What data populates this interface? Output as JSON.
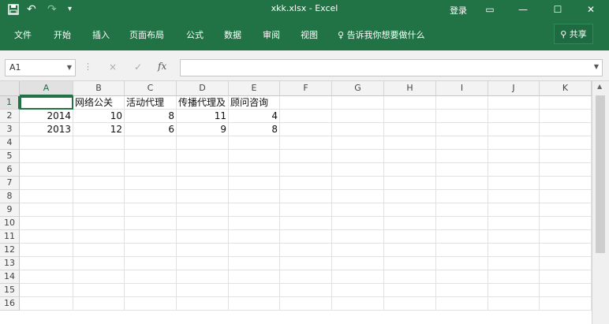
{
  "titlebar": {
    "title": "xkk.xlsx - Excel",
    "save_icon": "save-icon",
    "undo_icon": "undo-icon",
    "redo_icon": "redo-icon",
    "login": "登录",
    "window_buttons": [
      "ribbon-display-icon",
      "minimize-icon",
      "maximize-icon",
      "close-icon"
    ]
  },
  "ribbon": {
    "tabs": [
      "文件",
      "开始",
      "插入",
      "页面布局",
      "公式",
      "数据",
      "审阅",
      "视图"
    ],
    "tell_me": "告诉我你想要做什么",
    "share": "共享"
  },
  "formula_bar": {
    "name_box": "A1",
    "cancel_icon": "×",
    "enter_icon": "✓",
    "fx": "fx",
    "formula": ""
  },
  "sheet": {
    "columns": [
      "A",
      "B",
      "C",
      "D",
      "E",
      "F",
      "G",
      "H",
      "I",
      "J",
      "K"
    ],
    "rows": [
      "1",
      "2",
      "3",
      "4",
      "5",
      "6",
      "7",
      "8",
      "9",
      "10",
      "11",
      "12",
      "13",
      "14",
      "15",
      "16"
    ],
    "selected_cell": "A1",
    "cells": {
      "B1": "网络公关",
      "C1": "活动代理",
      "D1": "传播代理及",
      "E1": "顾问咨询",
      "A2": "2014",
      "B2": "10",
      "C2": "8",
      "D2": "11",
      "E2": "4",
      "A3": "2013",
      "B3": "12",
      "C3": "6",
      "D3": "9",
      "E3": "8"
    }
  },
  "colors": {
    "accent": "#217346"
  }
}
